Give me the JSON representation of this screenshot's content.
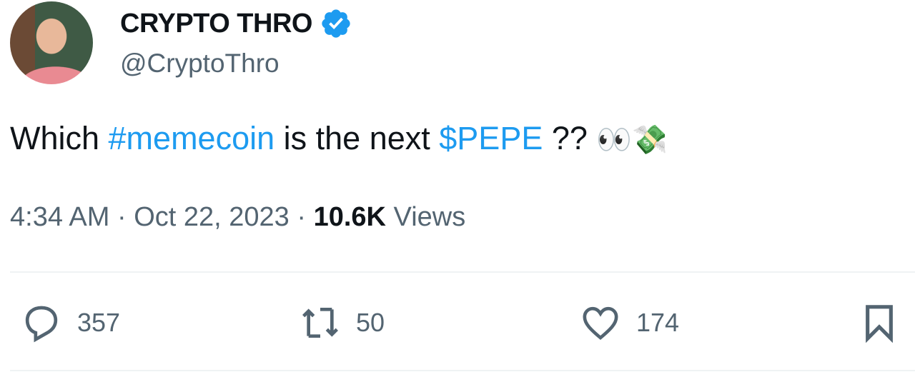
{
  "author": {
    "name": "CRYPTO THRO",
    "handle": "@CryptoThro",
    "verified": true,
    "verified_color": "#1d9bf0"
  },
  "tweet": {
    "text_parts": [
      {
        "text": "Which ",
        "type": "text"
      },
      {
        "text": "#memecoin",
        "type": "hashtag"
      },
      {
        "text": " is the next ",
        "type": "text"
      },
      {
        "text": "$PEPE",
        "type": "cashtag"
      },
      {
        "text": " ?? ",
        "type": "text"
      },
      {
        "text": "👀💸",
        "type": "emoji"
      }
    ]
  },
  "meta": {
    "time": "4:34 AM",
    "sep1": " · ",
    "date": "Oct 22, 2023",
    "sep2": " · ",
    "views_count": "10.6K",
    "views_label": " Views"
  },
  "actions": {
    "replies": "357",
    "reposts": "50",
    "likes": "174"
  },
  "colors": {
    "link": "#1d9bf0",
    "secondary": "#536471"
  }
}
